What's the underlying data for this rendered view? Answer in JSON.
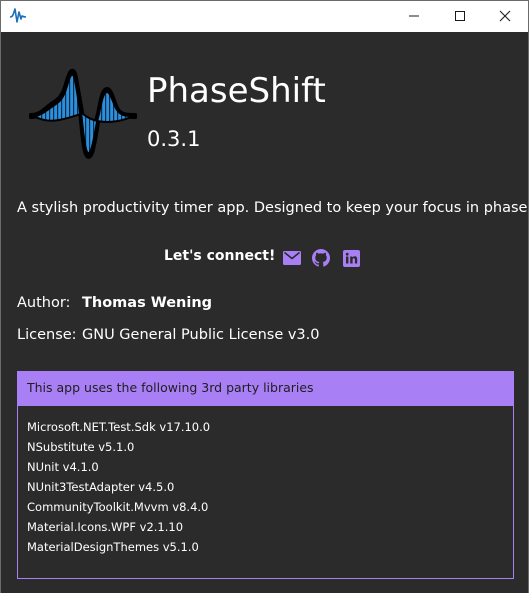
{
  "app": {
    "name": "PhaseShift",
    "version": "0.3.1",
    "tagline": "A stylish productivity timer app. Designed to keep your focus in phase."
  },
  "connect": {
    "label": "Let's connect!",
    "icons": [
      "mail-icon",
      "github-icon",
      "linkedin-icon"
    ]
  },
  "author": {
    "label": "Author:",
    "value": "Thomas Wening"
  },
  "license": {
    "label": "License:",
    "value": "GNU General Public License v3.0"
  },
  "libraries": {
    "header": "This app uses the following 3rd party libraries",
    "items": [
      "Microsoft.NET.Test.Sdk v17.10.0",
      "NSubstitute v5.1.0",
      "NUnit v4.1.0",
      "NUnit3TestAdapter v4.5.0",
      "CommunityToolkit.Mvvm v8.4.0",
      "Material.Icons.WPF v2.1.10",
      "MaterialDesignThemes v5.1.0"
    ]
  },
  "colors": {
    "accent": "#a97ff5",
    "background": "#2b2b2b",
    "logo_blue": "#2a8fdc"
  }
}
